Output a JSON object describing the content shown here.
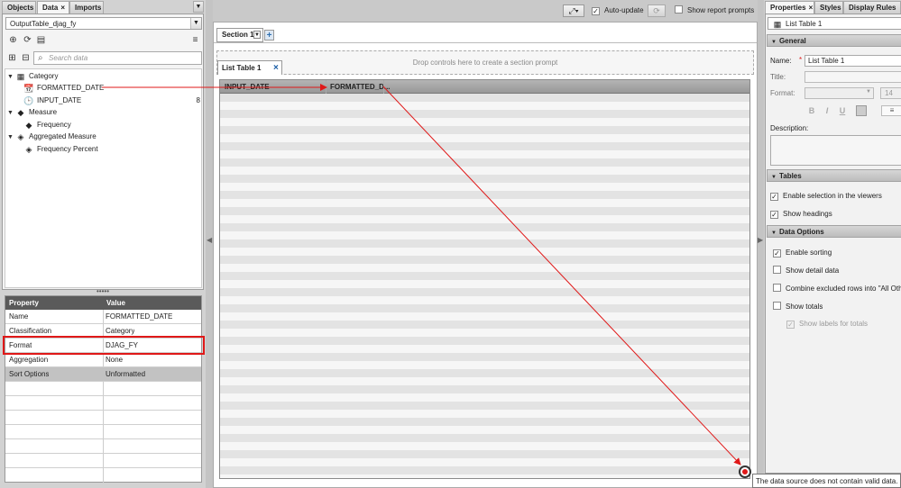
{
  "left_tabs": [
    {
      "label": "Objects"
    },
    {
      "label": "Data",
      "close": "×"
    },
    {
      "label": "Imports"
    }
  ],
  "data_source": "OutputTable_djag_fy",
  "search_placeholder": "Search data",
  "tree": {
    "category_label": "Category",
    "items_category": [
      "FORMATTED_DATE",
      "INPUT_DATE"
    ],
    "input_date_count": "8",
    "measure_label": "Measure",
    "items_measure": [
      "Frequency"
    ],
    "agg_label": "Aggregated Measure",
    "items_agg": [
      "Frequency Percent"
    ]
  },
  "props_table": {
    "header": [
      "Property",
      "Value"
    ],
    "rows": [
      [
        "Name",
        "FORMATTED_DATE"
      ],
      [
        "Classification",
        "Category"
      ],
      [
        "Format",
        "DJAG_FY"
      ],
      [
        "Aggregation",
        "None"
      ],
      [
        "Sort Options",
        "Unformatted"
      ]
    ]
  },
  "toolbar": {
    "auto_update": "Auto-update",
    "show_prompts": "Show report prompts"
  },
  "section_tab": "Section 1",
  "add_section": "+",
  "drop_hint": "Drop controls here to create a section prompt",
  "list_tab": "List Table 1",
  "list_tab_close": "×",
  "columns": [
    "INPUT_DATE",
    "FORMATTED_D..."
  ],
  "error_tooltip": "The data source does not contain valid data.",
  "right_tabs": [
    {
      "label": "Properties",
      "close": "×"
    },
    {
      "label": "Styles"
    },
    {
      "label": "Display Rules"
    }
  ],
  "object_select": "List Table 1",
  "general": {
    "header": "General",
    "name_label": "Name:",
    "name_required": "*",
    "name_value": "List Table 1",
    "title_label": "Title:",
    "format_label": "Format:",
    "font_size": "14",
    "format_buttons": [
      "B",
      "I",
      "U"
    ],
    "description_label": "Description:"
  },
  "tables": {
    "header": "Tables",
    "options": [
      {
        "label": "Enable selection in the viewers",
        "checked": true
      },
      {
        "label": "Show headings",
        "checked": true
      }
    ]
  },
  "data_options": {
    "header": "Data Options",
    "options": [
      {
        "label": "Enable sorting",
        "checked": true
      },
      {
        "label": "Show detail data",
        "checked": false
      },
      {
        "label": "Combine excluded rows into \"All Othe",
        "checked": false
      },
      {
        "label": "Show totals",
        "checked": false
      }
    ],
    "sub_option": "Show labels for totals"
  },
  "colors": {
    "arrow": "#e01818",
    "highlight_box": "#e01818",
    "table_header": "#5a5a5a",
    "stripe": "#e3e3e3"
  },
  "icons": [
    "new-data-item-icon",
    "refresh-icon",
    "delete-icon",
    "menu-icon",
    "expand-icon",
    "collapse-icon",
    "search-icon",
    "category-icon",
    "date-icon",
    "measure-icon",
    "aggregated-measure-icon",
    "error-icon"
  ]
}
